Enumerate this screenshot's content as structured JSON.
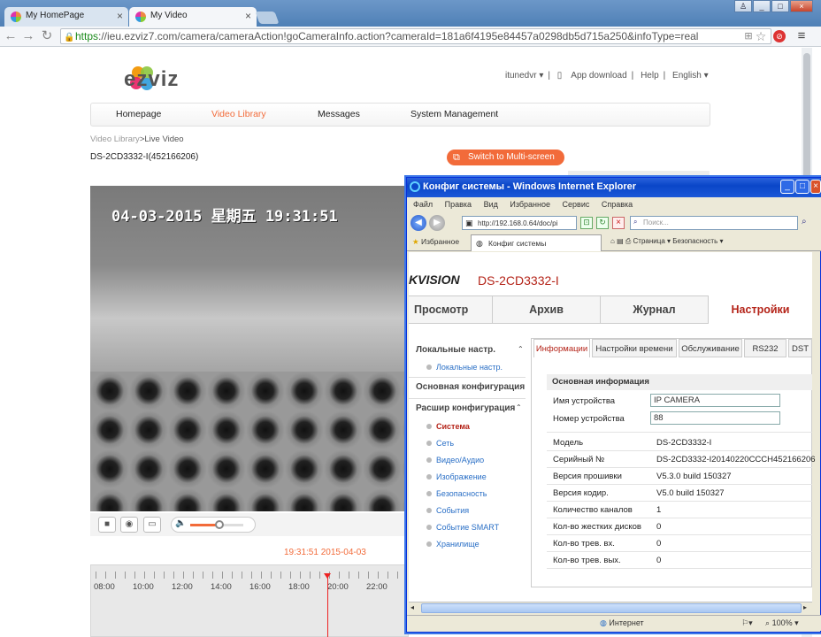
{
  "browser": {
    "tabs": [
      {
        "label": "My HomePage"
      },
      {
        "label": "My Video"
      }
    ],
    "url_scheme": "https",
    "url_rest": "://ieu.ezviz7.com/camera/cameraAction!goCameraInfo.action?cameraId=181a6f4195e84457a0298db5d715a250&infoType=real",
    "window_controls": {
      "min": "_",
      "max": "□",
      "close": "×"
    }
  },
  "site": {
    "logo_text": "ezviz",
    "top_links": {
      "user": "itunedvr ▾",
      "app": "App download",
      "help": "Help",
      "lang": "English ▾"
    },
    "nav": [
      "Homepage",
      "Video Library",
      "Messages",
      "System Management"
    ],
    "breadcrumb": {
      "root": "Video Library",
      "sep": ">",
      "current": "Live Video"
    },
    "camera_name": "DS-2CD3332-I(452166206)",
    "multiscreen_label": "Switch to Multi-screen",
    "osd_text": "04-03-2015 星期五 19:31:51",
    "volume_level": 0.55,
    "timestamp": "19:31:51 2015-04-03",
    "timeline_ticks": [
      "08:00",
      "10:00",
      "12:00",
      "14:00",
      "16:00",
      "18:00",
      "20:00",
      "22:00"
    ],
    "accent": "#f26b3a"
  },
  "ie": {
    "title": "Конфиг системы - Windows Internet Explorer",
    "menu": [
      "Файл",
      "Правка",
      "Вид",
      "Избранное",
      "Сервис",
      "Справка"
    ],
    "url": "http://192.168.0.64/doc/pi",
    "search_placeholder": "Поиск...",
    "favorites_label": "Избранное",
    "tab_label": "Конфиг системы",
    "commands": "Страница ▾   Безопасность ▾",
    "status_zone": "Интернет",
    "status_zoom": "100%"
  },
  "hik": {
    "logo": "KVISION",
    "model": "DS-2CD3332-I",
    "nav": [
      "Просмотр",
      "Архив",
      "Журнал",
      "Настройки"
    ],
    "side": {
      "local_head": "Локальные настр.",
      "local_items": [
        "Локальные настр."
      ],
      "basic_head": "Основная конфигурация",
      "adv_head": "Расшир конфигурация",
      "adv_items": [
        "Система",
        "Сеть",
        "Видео/Аудио",
        "Изображение",
        "Безопасность",
        "События",
        "Событие SMART",
        "Хранилище"
      ]
    },
    "tabs": [
      "Информации",
      "Настройки времени",
      "Обслуживание",
      "RS232",
      "DST"
    ],
    "section_title": "Основная информация",
    "fields": {
      "device_name_label": "Имя устройства",
      "device_name": "IP CAMERA",
      "device_no_label": "Номер устройства",
      "device_no": "88"
    },
    "info": [
      {
        "label": "Модель",
        "value": "DS-2CD3332-I"
      },
      {
        "label": "Серийный №",
        "value": "DS-2CD3332-I20140220CCCH452166206"
      },
      {
        "label": "Версия прошивки",
        "value": "V5.3.0 build 150327"
      },
      {
        "label": "Версия кодир.",
        "value": "V5.0 build 150327"
      },
      {
        "label": "Количество каналов",
        "value": "1"
      },
      {
        "label": "Кол-во жестких дисков",
        "value": "0"
      },
      {
        "label": "Кол-во трев. вх.",
        "value": "0"
      },
      {
        "label": "Кол-во трев. вых.",
        "value": "0"
      }
    ]
  }
}
